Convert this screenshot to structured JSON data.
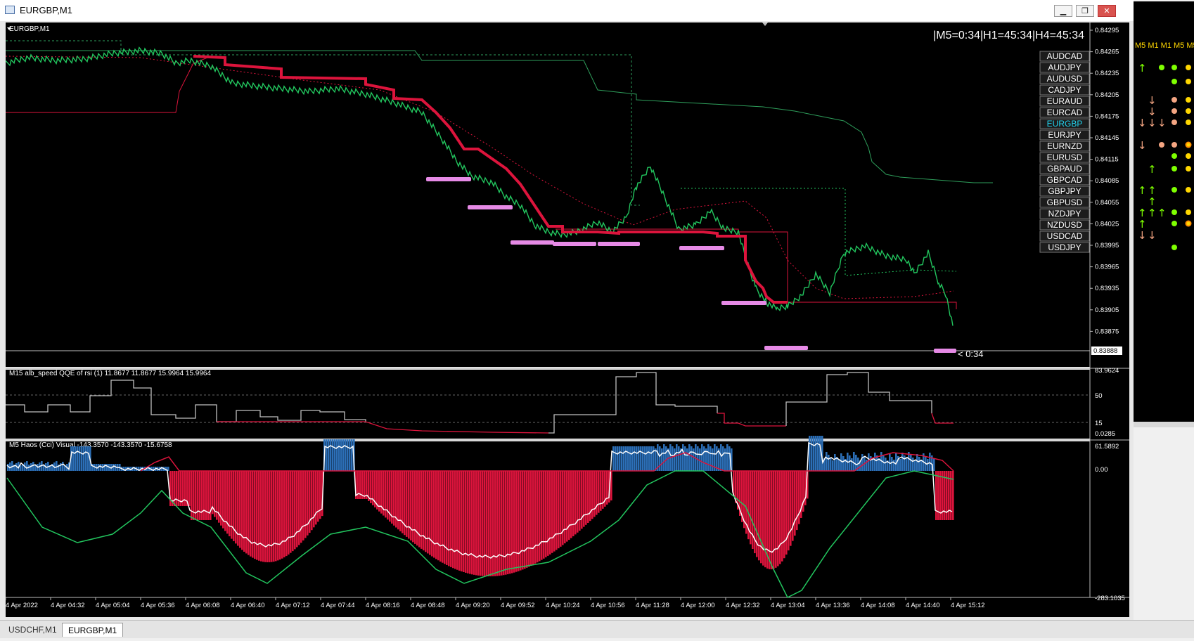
{
  "window": {
    "title": "EURGBP,M1",
    "minimize": "▁",
    "restore": "❐",
    "close": "✕"
  },
  "main_chart": {
    "label": "EURGBP,M1",
    "timer": "|M5=0:34|H1=45:34|H4=45:34",
    "countdown": "< 0:34",
    "current_price": "0.83888",
    "y_ticks": [
      "0.84295",
      "0.84265",
      "0.84235",
      "0.84205",
      "0.84175",
      "0.84145",
      "0.84115",
      "0.84085",
      "0.84055",
      "0.84025",
      "0.83995",
      "0.83965",
      "0.83935",
      "0.83905",
      "0.83875"
    ],
    "symbols": [
      "AUDCAD",
      "AUDJPY",
      "AUDUSD",
      "CADJPY",
      "EURAUD",
      "EURCAD",
      "EURGBP",
      "EURJPY",
      "EURNZD",
      "EURUSD",
      "GBPAUD",
      "GBPCAD",
      "GBPJPY",
      "GBPUSD",
      "NZDJPY",
      "NZDUSD",
      "USDCAD",
      "USDJPY"
    ],
    "active_symbol": "EURGBP"
  },
  "indicator1": {
    "label": "M15 alb_speed QQE of rsi (1) 11.8677 11.8677 15.9964 15.9964",
    "ticks": [
      "83.9624",
      "50",
      "15",
      "0.0285"
    ]
  },
  "indicator2": {
    "label": "M5 Haos (Cci) Visual -143.3570 -143.3570 -15.6758",
    "ticks": [
      "61.5892",
      "0.00",
      "-283.1035"
    ]
  },
  "x_axis": [
    "4 Apr 2022",
    "4 Apr 04:32",
    "4 Apr 05:04",
    "4 Apr 05:36",
    "4 Apr 06:08",
    "4 Apr 06:40",
    "4 Apr 07:12",
    "4 Apr 07:44",
    "4 Apr 08:16",
    "4 Apr 08:48",
    "4 Apr 09:20",
    "4 Apr 09:52",
    "4 Apr 10:24",
    "4 Apr 10:56",
    "4 Apr 11:28",
    "4 Apr 12:00",
    "4 Apr 12:32",
    "4 Apr 13:04",
    "4 Apr 13:36",
    "4 Apr 14:08",
    "4 Apr 14:40",
    "4 Apr 15:12"
  ],
  "side_panel": {
    "header": "M5 M1 M1 M5 M5"
  },
  "tabs": [
    "USDCHF,M1",
    "EURGBP,M1"
  ],
  "active_tab": "EURGBP,M1",
  "colors": {
    "bull": "#22c55e",
    "bear": "#dc143c",
    "qqe_line": "#c0c0c0",
    "support": "#e68ae6",
    "active_symbol": "#22d3ee"
  }
}
